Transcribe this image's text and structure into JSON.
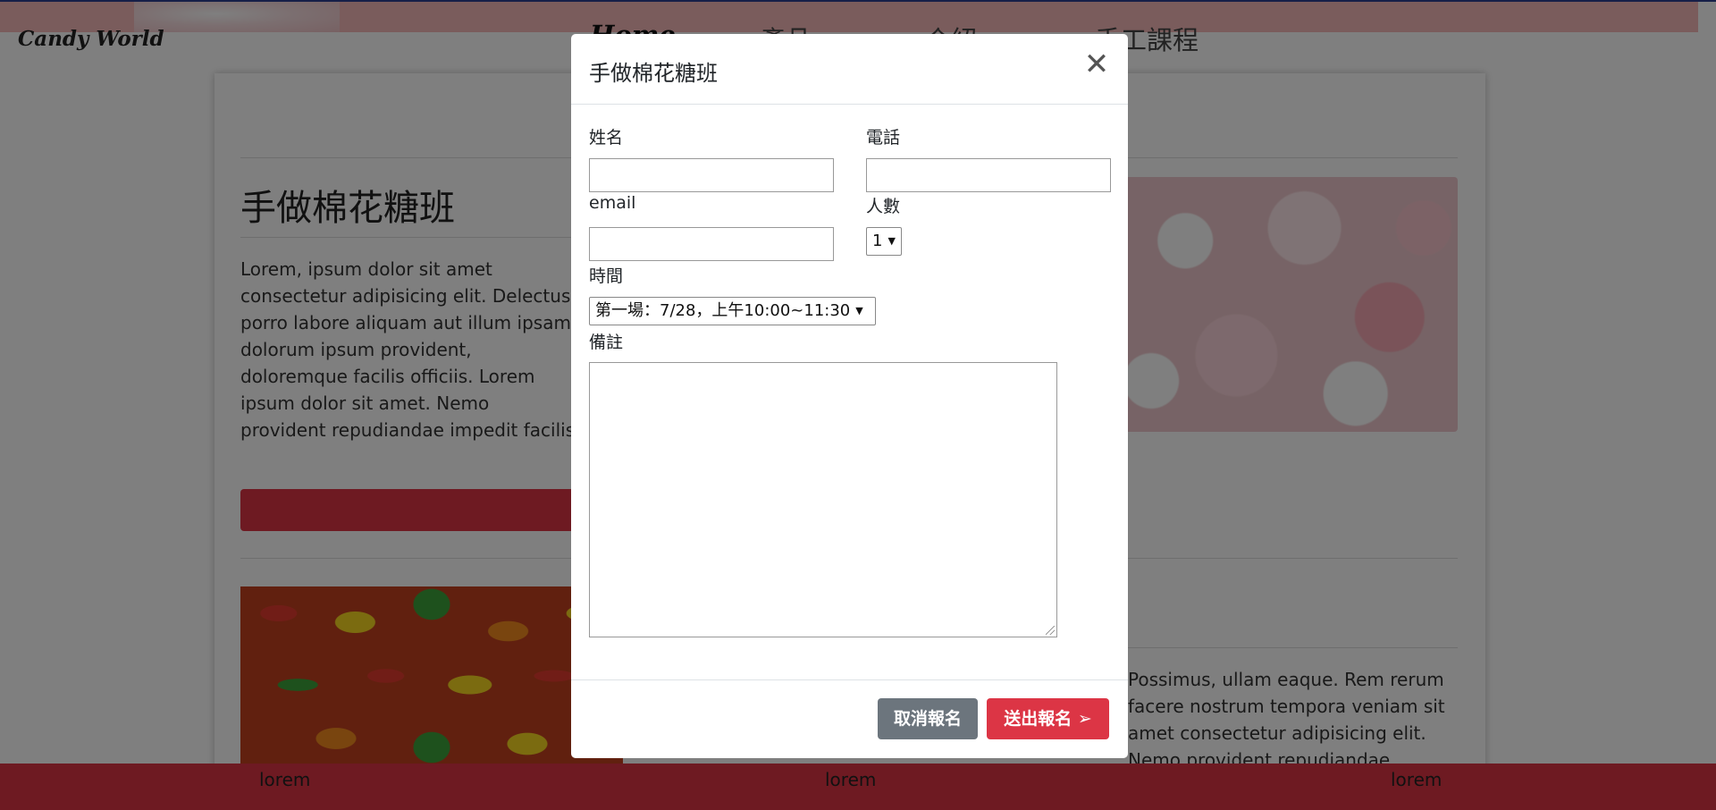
{
  "nav": {
    "brand": "Candy World",
    "links": [
      {
        "label": "Home",
        "active": true
      },
      {
        "label": "產品",
        "dropdown": true
      },
      {
        "label": "介紹"
      },
      {
        "label": "手工課程"
      }
    ]
  },
  "page": {
    "course_title": "手做棉花糖班",
    "intro": "Lorem, ipsum dolor sit amet consectetur adipisicing elit. Delectus porro labore aliquam aut illum ipsam dolorum ipsum provident, doloremque facilis officiis. Lorem ipsum dolor sit amet. Nemo provident repudiandae impedit facilis ipsam, modi soluta nulla quia dolor nostrum aut. Fugiat eveniet lorem ipsum dolor sit amet consectetur adipisicing elit. Nemo provident repudiandae modi soluta dolorem ut officiis, quisquam, nulla quia dolor.",
    "second_para": "Possimus, ullam eaque. Rem rerum facere nostrum tempora veniam sit amet consectetur adipisicing elit. Nemo provident repudiandae impedit facilis ipsam, modi soluta dolorem ut officiis, quisquam"
  },
  "footer": {
    "items": [
      "lorem",
      "lorem",
      "lorem"
    ]
  },
  "modal": {
    "title": "手做棉花糖班",
    "close_icon": "close-icon",
    "fields": {
      "name_label": "姓名",
      "phone_label": "電話",
      "email_label": "email",
      "people_label": "人數",
      "people_value": "1",
      "time_label": "時間",
      "time_value": "第一場：7/28，上午10:00~11:30",
      "note_label": "備註"
    },
    "buttons": {
      "cancel": "取消報名",
      "submit": "送出報名",
      "submit_icon": "paper-plane-icon"
    }
  },
  "colors": {
    "accent_red": "#dc3545",
    "secondary_gray": "#6c757d",
    "nav_pink": "#f4b9b8"
  }
}
